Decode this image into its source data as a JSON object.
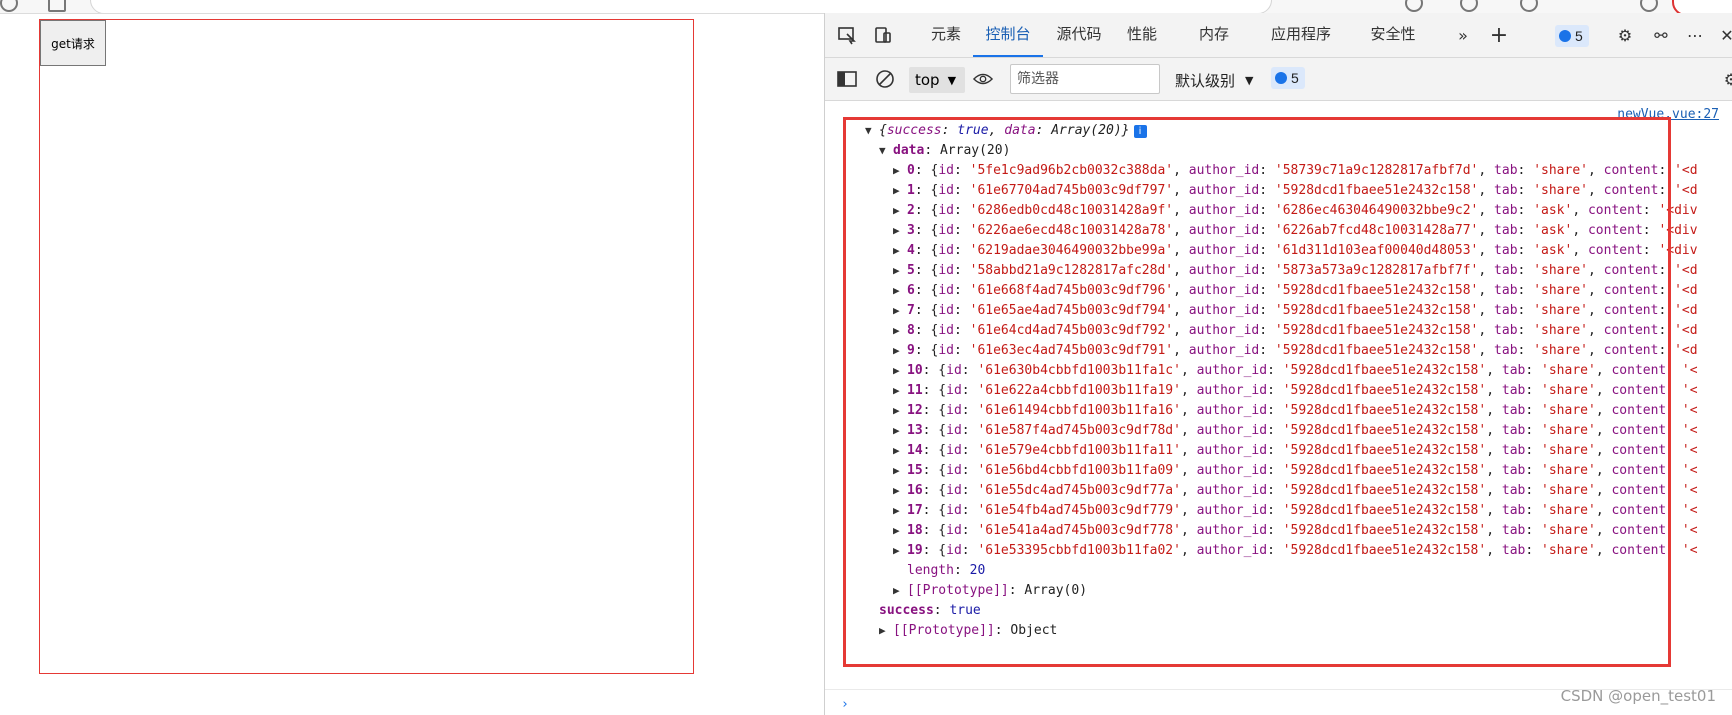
{
  "page": {
    "button_label": "get请求"
  },
  "devtools": {
    "tabs": [
      "元素",
      "控制台",
      "源代码",
      "性能",
      "内存",
      "应用程序",
      "安全性"
    ],
    "active_tab": "控制台",
    "issues_count": "5",
    "toolbar": {
      "context": "top",
      "filter_placeholder": "筛选器",
      "levels": "默认级别",
      "issues_count": "5"
    }
  },
  "console": {
    "source_link": "newVue.vue:27",
    "summary": {
      "prefix": "{",
      "success_key": "success",
      "success_val": "true",
      "data_key": "data",
      "data_val": "Array(20)",
      "suffix": "}"
    },
    "data_label": "data",
    "data_type": "Array(20)",
    "rows": [
      {
        "idx": "0",
        "id": "'5fe1c9ad96b2cb0032c388da'",
        "author_id": "'58739c71a9c1282817afbf7d'",
        "tab": "'share'",
        "content": "'<d"
      },
      {
        "idx": "1",
        "id": "'61e67704ad745b003c9df797'",
        "author_id": "'5928dcd1fbaee51e2432c158'",
        "tab": "'share'",
        "content": "'<d"
      },
      {
        "idx": "2",
        "id": "'6286edb0cd48c10031428a9f'",
        "author_id": "'6286ec463046490032bbe9c2'",
        "tab": "'ask'",
        "content": "'<div"
      },
      {
        "idx": "3",
        "id": "'6226ae6ecd48c10031428a78'",
        "author_id": "'6226ab7fcd48c10031428a77'",
        "tab": "'ask'",
        "content": "'<div"
      },
      {
        "idx": "4",
        "id": "'6219adae3046490032bbe99a'",
        "author_id": "'61d311d103eaf00040d48053'",
        "tab": "'ask'",
        "content": "'<div"
      },
      {
        "idx": "5",
        "id": "'58abbd21a9c1282817afc28d'",
        "author_id": "'5873a573a9c1282817afbf7f'",
        "tab": "'share'",
        "content": "'<d"
      },
      {
        "idx": "6",
        "id": "'61e668f4ad745b003c9df796'",
        "author_id": "'5928dcd1fbaee51e2432c158'",
        "tab": "'share'",
        "content": "'<d"
      },
      {
        "idx": "7",
        "id": "'61e65ae4ad745b003c9df794'",
        "author_id": "'5928dcd1fbaee51e2432c158'",
        "tab": "'share'",
        "content": "'<d"
      },
      {
        "idx": "8",
        "id": "'61e64cd4ad745b003c9df792'",
        "author_id": "'5928dcd1fbaee51e2432c158'",
        "tab": "'share'",
        "content": "'<d"
      },
      {
        "idx": "9",
        "id": "'61e63ec4ad745b003c9df791'",
        "author_id": "'5928dcd1fbaee51e2432c158'",
        "tab": "'share'",
        "content": "'<d"
      },
      {
        "idx": "10",
        "id": "'61e630b4cbbfd1003b11fa1c'",
        "author_id": "'5928dcd1fbaee51e2432c158'",
        "tab": "'share'",
        "content": "'<"
      },
      {
        "idx": "11",
        "id": "'61e622a4cbbfd1003b11fa19'",
        "author_id": "'5928dcd1fbaee51e2432c158'",
        "tab": "'share'",
        "content": "'<"
      },
      {
        "idx": "12",
        "id": "'61e61494cbbfd1003b11fa16'",
        "author_id": "'5928dcd1fbaee51e2432c158'",
        "tab": "'share'",
        "content": "'<"
      },
      {
        "idx": "13",
        "id": "'61e587f4ad745b003c9df78d'",
        "author_id": "'5928dcd1fbaee51e2432c158'",
        "tab": "'share'",
        "content": "'<"
      },
      {
        "idx": "14",
        "id": "'61e579e4cbbfd1003b11fa11'",
        "author_id": "'5928dcd1fbaee51e2432c158'",
        "tab": "'share'",
        "content": "'<"
      },
      {
        "idx": "15",
        "id": "'61e56bd4cbbfd1003b11fa09'",
        "author_id": "'5928dcd1fbaee51e2432c158'",
        "tab": "'share'",
        "content": "'<"
      },
      {
        "idx": "16",
        "id": "'61e55dc4ad745b003c9df77a'",
        "author_id": "'5928dcd1fbaee51e2432c158'",
        "tab": "'share'",
        "content": "'<"
      },
      {
        "idx": "17",
        "id": "'61e54fb4ad745b003c9df779'",
        "author_id": "'5928dcd1fbaee51e2432c158'",
        "tab": "'share'",
        "content": "'<"
      },
      {
        "idx": "18",
        "id": "'61e541a4ad745b003c9df778'",
        "author_id": "'5928dcd1fbaee51e2432c158'",
        "tab": "'share'",
        "content": "'<"
      },
      {
        "idx": "19",
        "id": "'61e53395cbbfd1003b11fa02'",
        "author_id": "'5928dcd1fbaee51e2432c158'",
        "tab": "'share'",
        "content": "'<"
      }
    ],
    "length_key": "length",
    "length_val": "20",
    "proto_array_key": "[[Prototype]]",
    "proto_array_val": "Array(0)",
    "success_key": "success",
    "success_val": "true",
    "proto_obj_key": "[[Prototype]]",
    "proto_obj_val": "Object",
    "prompt": "›"
  },
  "watermark": "CSDN @open_test01"
}
